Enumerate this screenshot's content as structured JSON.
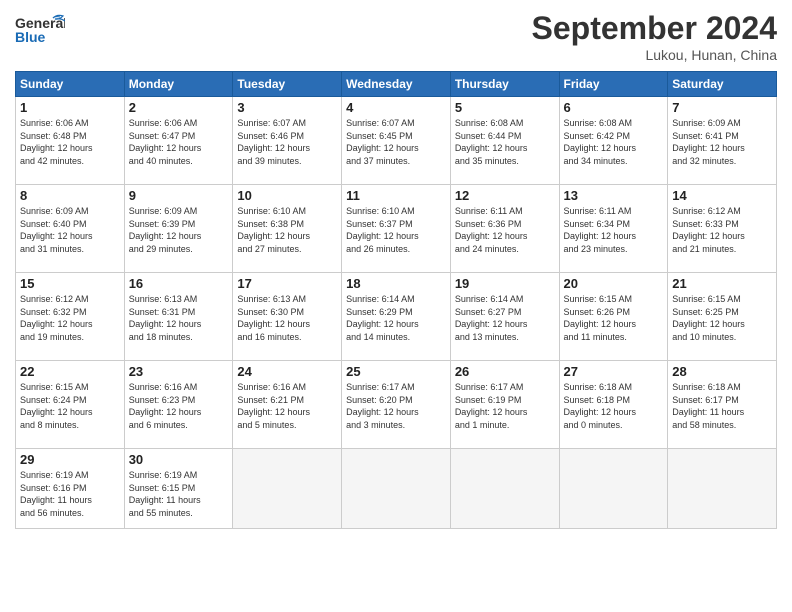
{
  "header": {
    "logo_general": "General",
    "logo_blue": "Blue",
    "month_title": "September 2024",
    "location": "Lukou, Hunan, China"
  },
  "weekdays": [
    "Sunday",
    "Monday",
    "Tuesday",
    "Wednesday",
    "Thursday",
    "Friday",
    "Saturday"
  ],
  "weeks": [
    [
      {
        "day": "1",
        "info": "Sunrise: 6:06 AM\nSunset: 6:48 PM\nDaylight: 12 hours\nand 42 minutes."
      },
      {
        "day": "2",
        "info": "Sunrise: 6:06 AM\nSunset: 6:47 PM\nDaylight: 12 hours\nand 40 minutes."
      },
      {
        "day": "3",
        "info": "Sunrise: 6:07 AM\nSunset: 6:46 PM\nDaylight: 12 hours\nand 39 minutes."
      },
      {
        "day": "4",
        "info": "Sunrise: 6:07 AM\nSunset: 6:45 PM\nDaylight: 12 hours\nand 37 minutes."
      },
      {
        "day": "5",
        "info": "Sunrise: 6:08 AM\nSunset: 6:44 PM\nDaylight: 12 hours\nand 35 minutes."
      },
      {
        "day": "6",
        "info": "Sunrise: 6:08 AM\nSunset: 6:42 PM\nDaylight: 12 hours\nand 34 minutes."
      },
      {
        "day": "7",
        "info": "Sunrise: 6:09 AM\nSunset: 6:41 PM\nDaylight: 12 hours\nand 32 minutes."
      }
    ],
    [
      {
        "day": "8",
        "info": "Sunrise: 6:09 AM\nSunset: 6:40 PM\nDaylight: 12 hours\nand 31 minutes."
      },
      {
        "day": "9",
        "info": "Sunrise: 6:09 AM\nSunset: 6:39 PM\nDaylight: 12 hours\nand 29 minutes."
      },
      {
        "day": "10",
        "info": "Sunrise: 6:10 AM\nSunset: 6:38 PM\nDaylight: 12 hours\nand 27 minutes."
      },
      {
        "day": "11",
        "info": "Sunrise: 6:10 AM\nSunset: 6:37 PM\nDaylight: 12 hours\nand 26 minutes."
      },
      {
        "day": "12",
        "info": "Sunrise: 6:11 AM\nSunset: 6:36 PM\nDaylight: 12 hours\nand 24 minutes."
      },
      {
        "day": "13",
        "info": "Sunrise: 6:11 AM\nSunset: 6:34 PM\nDaylight: 12 hours\nand 23 minutes."
      },
      {
        "day": "14",
        "info": "Sunrise: 6:12 AM\nSunset: 6:33 PM\nDaylight: 12 hours\nand 21 minutes."
      }
    ],
    [
      {
        "day": "15",
        "info": "Sunrise: 6:12 AM\nSunset: 6:32 PM\nDaylight: 12 hours\nand 19 minutes."
      },
      {
        "day": "16",
        "info": "Sunrise: 6:13 AM\nSunset: 6:31 PM\nDaylight: 12 hours\nand 18 minutes."
      },
      {
        "day": "17",
        "info": "Sunrise: 6:13 AM\nSunset: 6:30 PM\nDaylight: 12 hours\nand 16 minutes."
      },
      {
        "day": "18",
        "info": "Sunrise: 6:14 AM\nSunset: 6:29 PM\nDaylight: 12 hours\nand 14 minutes."
      },
      {
        "day": "19",
        "info": "Sunrise: 6:14 AM\nSunset: 6:27 PM\nDaylight: 12 hours\nand 13 minutes."
      },
      {
        "day": "20",
        "info": "Sunrise: 6:15 AM\nSunset: 6:26 PM\nDaylight: 12 hours\nand 11 minutes."
      },
      {
        "day": "21",
        "info": "Sunrise: 6:15 AM\nSunset: 6:25 PM\nDaylight: 12 hours\nand 10 minutes."
      }
    ],
    [
      {
        "day": "22",
        "info": "Sunrise: 6:15 AM\nSunset: 6:24 PM\nDaylight: 12 hours\nand 8 minutes."
      },
      {
        "day": "23",
        "info": "Sunrise: 6:16 AM\nSunset: 6:23 PM\nDaylight: 12 hours\nand 6 minutes."
      },
      {
        "day": "24",
        "info": "Sunrise: 6:16 AM\nSunset: 6:21 PM\nDaylight: 12 hours\nand 5 minutes."
      },
      {
        "day": "25",
        "info": "Sunrise: 6:17 AM\nSunset: 6:20 PM\nDaylight: 12 hours\nand 3 minutes."
      },
      {
        "day": "26",
        "info": "Sunrise: 6:17 AM\nSunset: 6:19 PM\nDaylight: 12 hours\nand 1 minute."
      },
      {
        "day": "27",
        "info": "Sunrise: 6:18 AM\nSunset: 6:18 PM\nDaylight: 12 hours\nand 0 minutes."
      },
      {
        "day": "28",
        "info": "Sunrise: 6:18 AM\nSunset: 6:17 PM\nDaylight: 11 hours\nand 58 minutes."
      }
    ],
    [
      {
        "day": "29",
        "info": "Sunrise: 6:19 AM\nSunset: 6:16 PM\nDaylight: 11 hours\nand 56 minutes."
      },
      {
        "day": "30",
        "info": "Sunrise: 6:19 AM\nSunset: 6:15 PM\nDaylight: 11 hours\nand 55 minutes."
      },
      {
        "day": "",
        "info": ""
      },
      {
        "day": "",
        "info": ""
      },
      {
        "day": "",
        "info": ""
      },
      {
        "day": "",
        "info": ""
      },
      {
        "day": "",
        "info": ""
      }
    ]
  ]
}
